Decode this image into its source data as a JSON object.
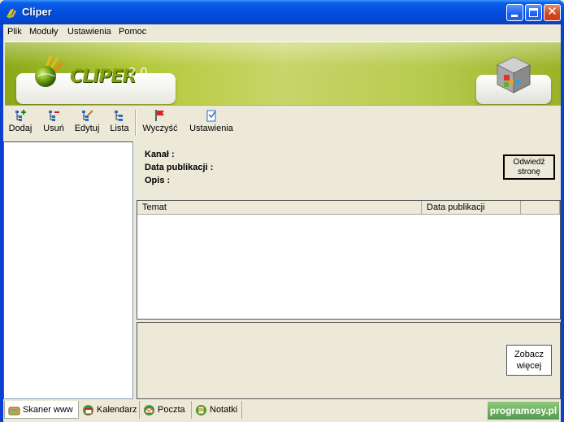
{
  "window": {
    "title": "Cliper"
  },
  "menu": {
    "items": [
      "Plik",
      "Moduły",
      "Ustawienia",
      "Pomoc"
    ]
  },
  "banner": {
    "logo_text": "CLIPER",
    "version": "2.0"
  },
  "toolbar": {
    "group1": [
      {
        "label": "Dodaj",
        "icon": "tree-add-icon"
      },
      {
        "label": "Usuń",
        "icon": "tree-remove-icon"
      },
      {
        "label": "Edytuj",
        "icon": "tree-edit-icon"
      },
      {
        "label": "Lista",
        "icon": "tree-list-icon"
      }
    ],
    "group2": [
      {
        "label": "Wyczyść",
        "icon": "red-flag-icon"
      },
      {
        "label": "Ustawienia",
        "icon": "settings-doc-icon"
      }
    ]
  },
  "info": {
    "channel_label": "Kanał :",
    "channel_value": "",
    "pubdate_label": "Data publikacji :",
    "pubdate_value": "",
    "description_label": "Opis :",
    "description_value": "",
    "visit_button": [
      "Odwiedź",
      "stronę"
    ]
  },
  "table": {
    "columns": [
      "Temat",
      "Data publikacji",
      ""
    ],
    "rows": []
  },
  "detail": {
    "more_button": [
      "Zobacz",
      "więcej"
    ]
  },
  "tabs": [
    {
      "label": "Skaner www",
      "icon": "scanner-icon",
      "active": true
    },
    {
      "label": "Kalendarz",
      "icon": "calendar-icon",
      "active": false
    },
    {
      "label": "Poczta",
      "icon": "mail-icon",
      "active": false
    },
    {
      "label": "Notatki",
      "icon": "notes-icon",
      "active": false
    }
  ],
  "watermark": "programosy.pl",
  "colors": {
    "title_bar": "#0548d4",
    "banner_green": "#b4c93a",
    "window_bg": "#ece9d8",
    "close_button": "#d2451f"
  }
}
